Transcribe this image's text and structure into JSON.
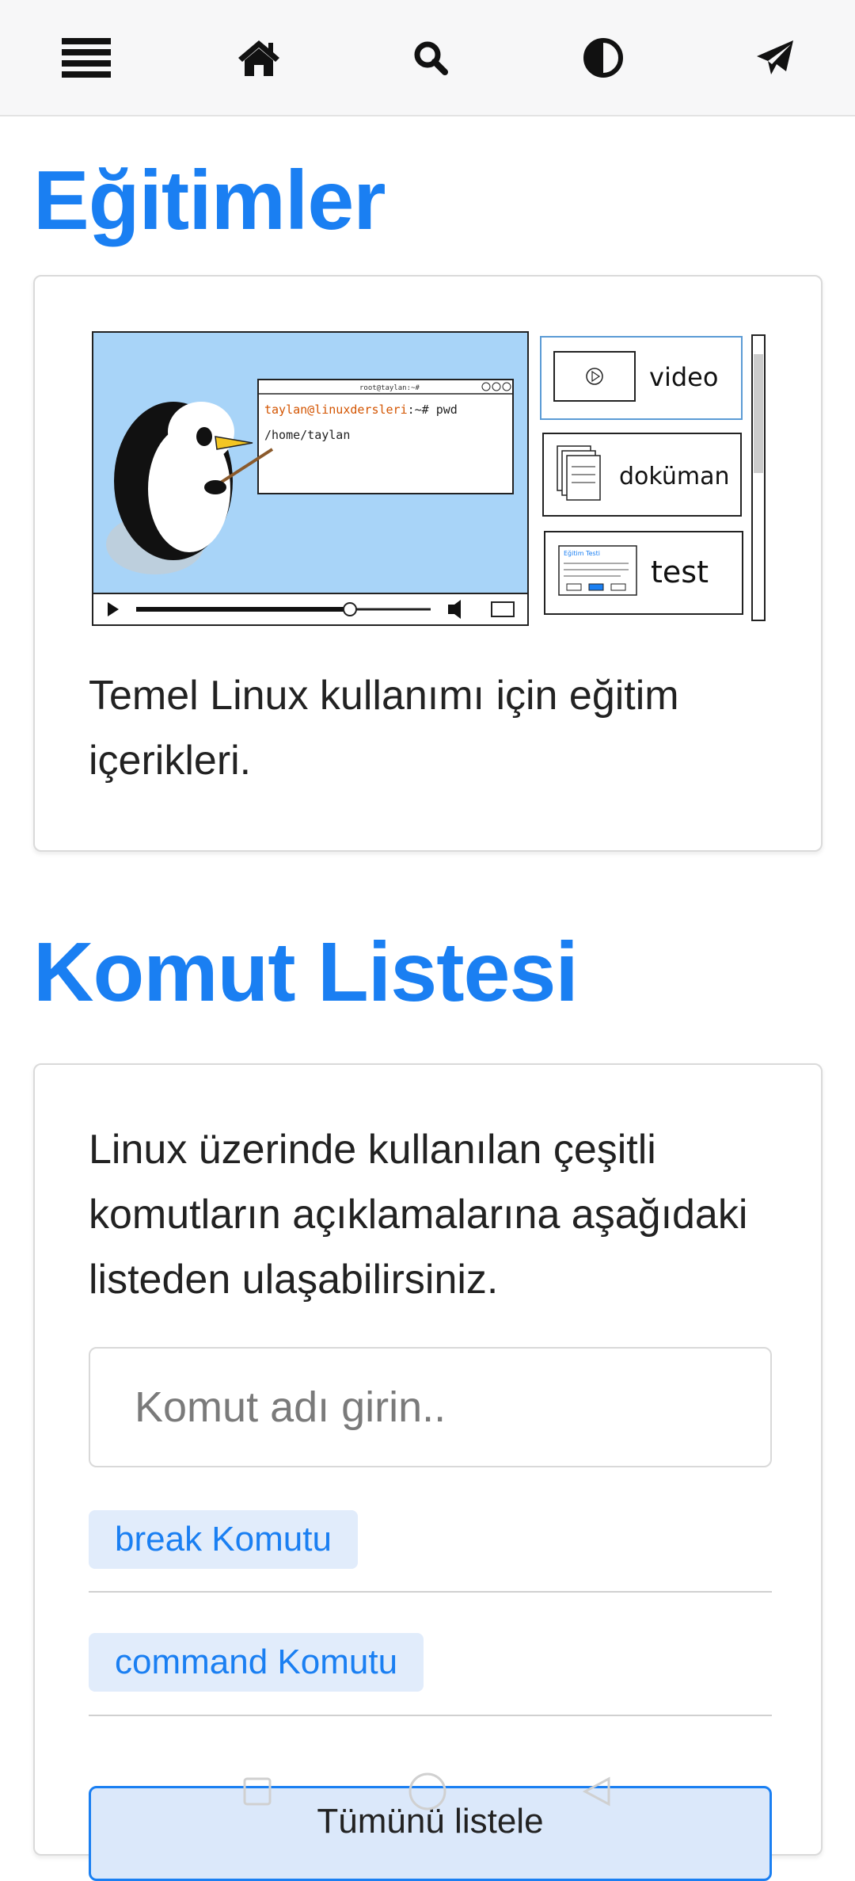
{
  "topbar": {
    "icons": [
      "menu-icon",
      "home-icon",
      "search-icon",
      "contrast-icon",
      "paper-plane-icon"
    ]
  },
  "tutorials": {
    "title": "Eğitimler",
    "illustration": {
      "terminal_title": "root@taylan:~#",
      "terminal_prompt_user": "taylan@linuxdersleri",
      "terminal_prompt_rest": ":~# pwd",
      "terminal_output": "/home/taylan",
      "side_items": [
        "video",
        "doküman",
        "test"
      ],
      "dialog_title": "Eğitim Testi"
    },
    "description": "Temel Linux kullanımı için eğitim içerikleri."
  },
  "commands": {
    "title": "Komut Listesi",
    "description": "Linux üzerinde kullanılan çeşitli komutların açıklamalarına aşağıdaki listeden ulaşabilirsiniz.",
    "search_placeholder": "Komut adı girin..",
    "items": [
      "break Komutu",
      "command Komutu"
    ],
    "list_all_label": "Tümünü listele"
  },
  "colors": {
    "accent": "#1a7ff2",
    "tag_bg": "#e1ecfb",
    "topbar_bg": "#f7f7f8"
  }
}
